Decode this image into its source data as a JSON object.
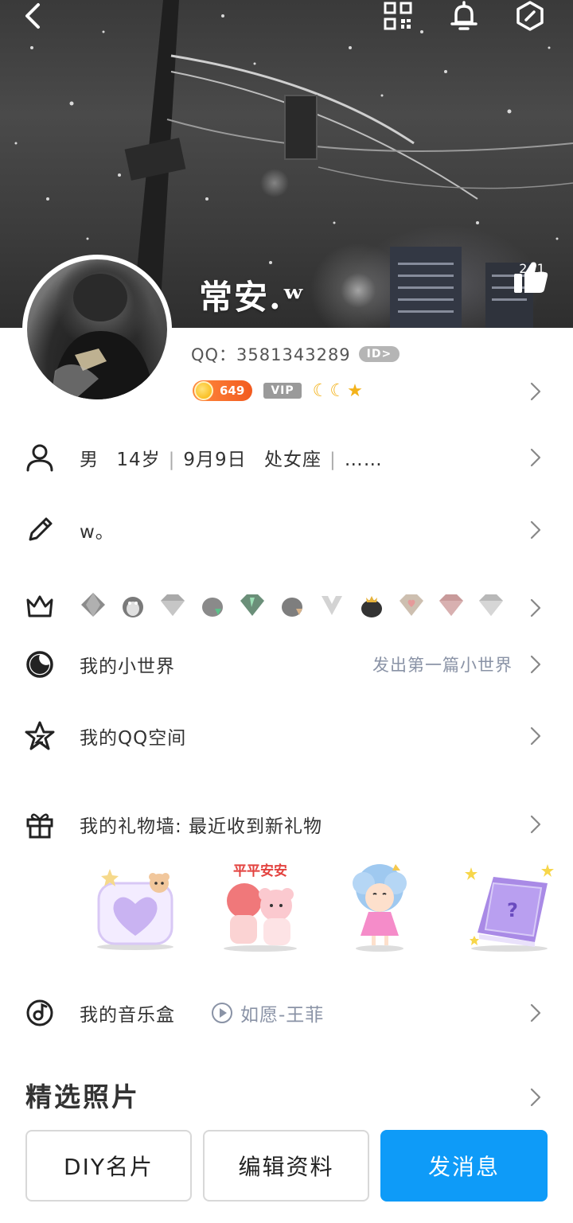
{
  "profile": {
    "nickname": "常安.ʷ",
    "qq_label": "QQ：3581343289",
    "id_badge": "ID>",
    "coin_value": "649",
    "vip_label": "VIP",
    "likes": "261"
  },
  "rows": {
    "basic_gender": "男",
    "basic_age": "14岁",
    "basic_birthday": "9月9日",
    "basic_zodiac": "处女座",
    "basic_more": "……",
    "signature": "w。",
    "small_world_label": "我的小世界",
    "small_world_hint": "发出第一篇小世界",
    "qzone_label": "我的QQ空间",
    "gift_label": "我的礼物墙: 最近收到新礼物",
    "music_label": "我的音乐盒",
    "music_song": "如愿-王菲"
  },
  "gift_images": [
    {
      "name": "heart-pillow-bear"
    },
    {
      "name": "pingping-anan",
      "text": "平平安安"
    },
    {
      "name": "blue-hair-girl"
    },
    {
      "name": "purple-book"
    }
  ],
  "photos_title": "精选照片",
  "buttons": {
    "diy": "DIY名片",
    "edit": "编辑资料",
    "message": "发消息"
  },
  "colors": {
    "primary": "#0e9bf8",
    "coin_orange": "#f25a1f",
    "hint_gray": "#8a93a6"
  }
}
